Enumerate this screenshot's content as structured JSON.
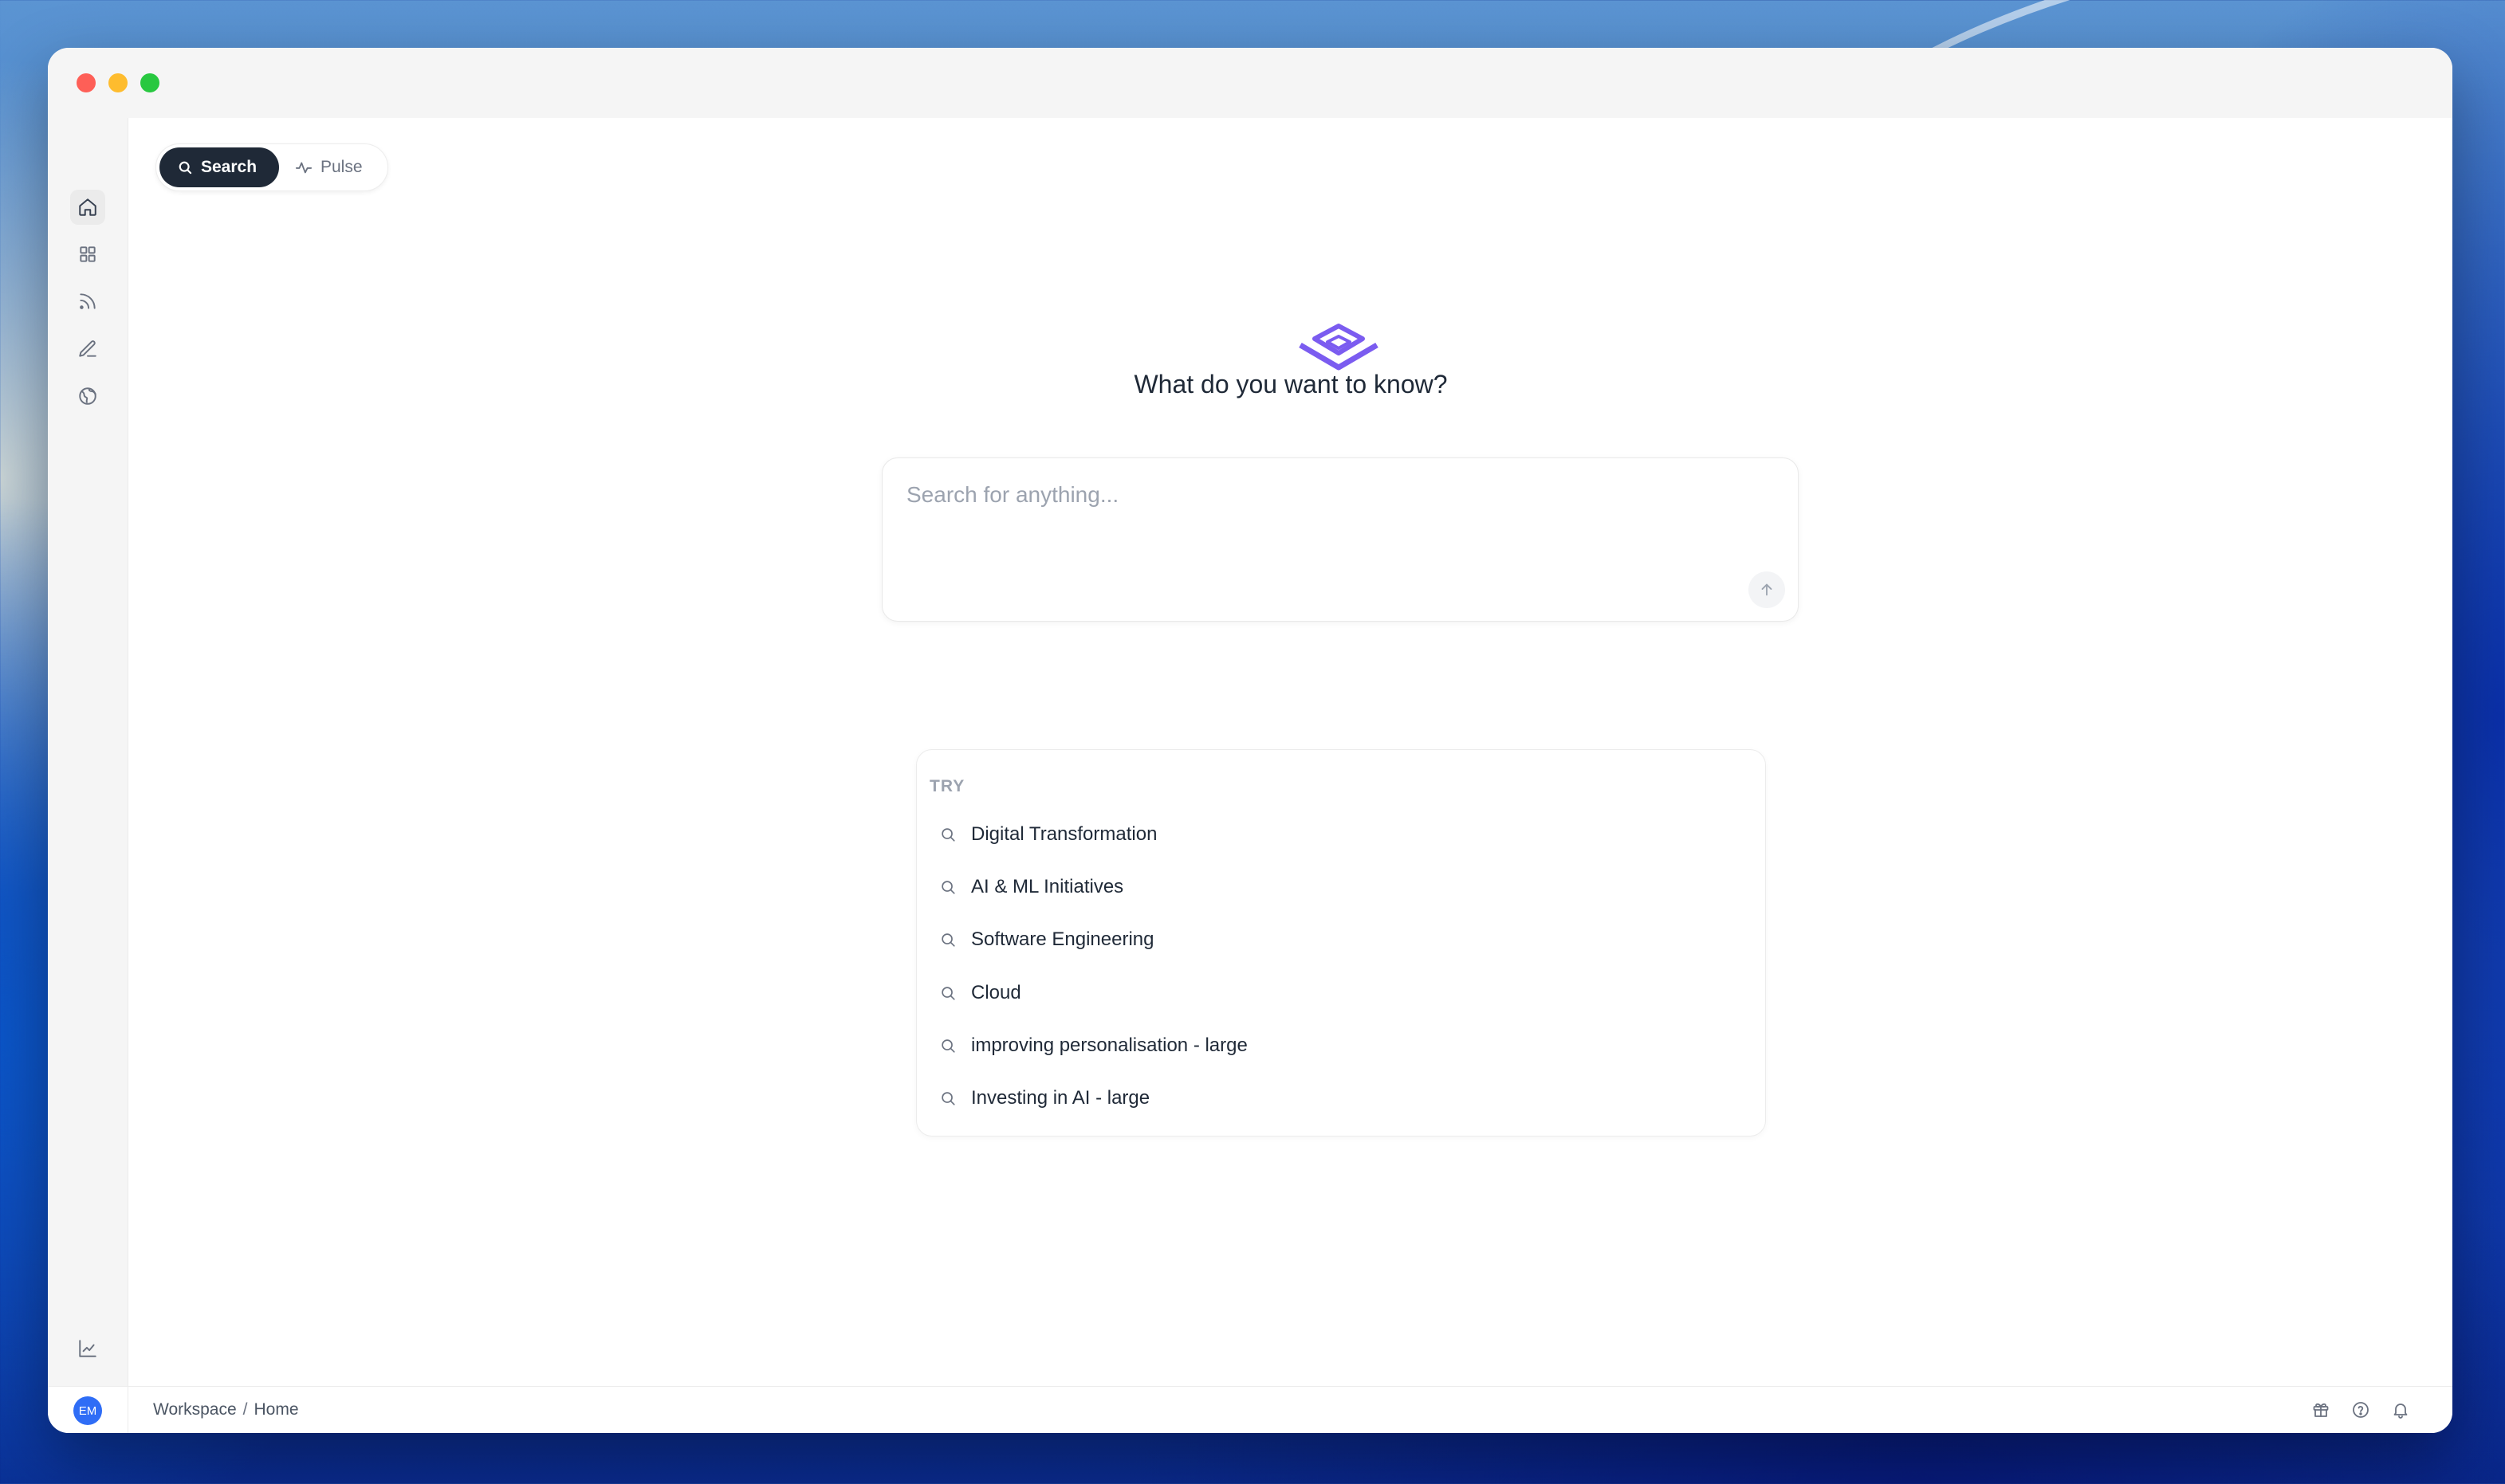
{
  "modes": {
    "search_label": "Search",
    "pulse_label": "Pulse"
  },
  "headline": "What do you want to know?",
  "search": {
    "placeholder": "Search for anything..."
  },
  "suggestions": {
    "heading": "TRY",
    "items": [
      {
        "label": "Digital Transformation"
      },
      {
        "label": "AI & ML Initiatives"
      },
      {
        "label": "Software Engineering"
      },
      {
        "label": "Cloud"
      },
      {
        "label": "improving personalisation - large"
      },
      {
        "label": "Investing in AI - large"
      }
    ]
  },
  "user": {
    "initials": "EM"
  },
  "breadcrumb": {
    "workspace": "Workspace",
    "separator": "/",
    "page": "Home"
  },
  "sidebar": {
    "top_icons": [
      "home-icon",
      "grid-icon",
      "rss-icon",
      "pencil-icon",
      "globe-icon"
    ],
    "bottom_icons": [
      "analytics-icon",
      "settings-icon"
    ]
  },
  "footer_icons": [
    "gift-icon",
    "help-icon",
    "bell-icon"
  ],
  "colors": {
    "accent": "#7b5cf0",
    "active_mode_bg": "#1f2937",
    "avatar_bg": "#2f6df6"
  }
}
